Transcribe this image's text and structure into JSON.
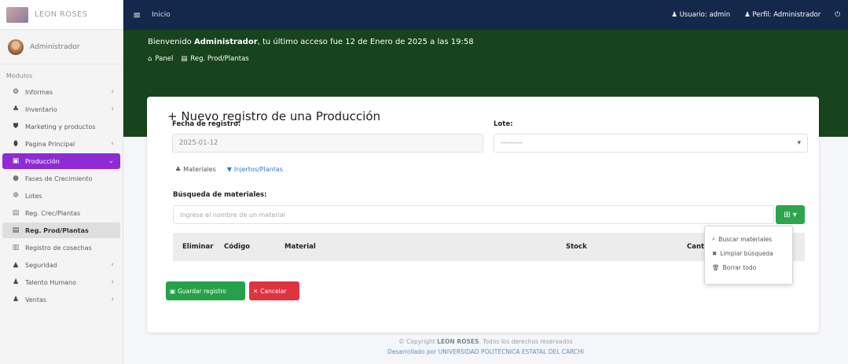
{
  "brand": {
    "name": "LEON ROSES"
  },
  "user": {
    "name": "Administrador"
  },
  "sidebar": {
    "section_label": "Modulos",
    "items": [
      {
        "icon": "⚙",
        "label": "Informes",
        "chevron": "‹"
      },
      {
        "icon": "♣",
        "label": "Inventario",
        "chevron": "‹"
      },
      {
        "icon": "⛊",
        "label": "Marketing y productos",
        "chevron": ""
      },
      {
        "icon": "⬮",
        "label": "Pagina Principal",
        "chevron": "‹"
      },
      {
        "icon": "▣",
        "label": "Producción",
        "chevron": "⌄"
      },
      {
        "icon": "●",
        "label": "Fases de Crecimiento",
        "chevron": ""
      },
      {
        "icon": "❁",
        "label": "Lotes",
        "chevron": ""
      },
      {
        "icon": "▤",
        "label": "Reg. Crec/Plantas",
        "chevron": ""
      },
      {
        "icon": "▤",
        "label": "Reg. Prod/Plantas",
        "chevron": ""
      },
      {
        "icon": "▥",
        "label": "Registro de cosechas",
        "chevron": ""
      },
      {
        "icon": "▲",
        "label": "Seguridad",
        "chevron": "‹"
      },
      {
        "icon": "♟",
        "label": "Talento Humano",
        "chevron": "‹"
      },
      {
        "icon": "♟",
        "label": "Ventas",
        "chevron": "‹"
      }
    ]
  },
  "topbar": {
    "menu_icon": "≡",
    "home_label": "Inicio",
    "user_link": "Usuario: admin",
    "profile_link": "Perfil: Administrador",
    "power_icon": "⏻"
  },
  "header": {
    "welcome_prefix": "Bienvenido ",
    "welcome_user": "Administrador",
    "welcome_suffix": ", tu último acceso fue 12 de Enero de 2025 a las 19:58",
    "breadcrumb_home": "Panel",
    "breadcrumb_current": "Reg. Prod/Plantas"
  },
  "form": {
    "title": "+ Nuevo registro de una Producción",
    "date_label": "Fecha de registro:",
    "date_value": "2025-01-12",
    "lot_label": "Lote:",
    "lot_value": "---------",
    "tab_materials": "Materiales",
    "tab_plants": "Injertos/Plantas",
    "search_label": "Búsqueda de materiales:",
    "search_placeholder": "Ingrese el nombre de un material",
    "search_button_icon": "⊞ ▾",
    "table_columns": [
      "Eliminar",
      "Código",
      "Material",
      "Stock",
      "Cant"
    ],
    "save_button": "Guardar registro",
    "cancel_button": "Cancelar"
  },
  "dropdown": {
    "items": [
      {
        "icon": "⌕",
        "label": "Buscar materiales"
      },
      {
        "icon": "✖",
        "label": "Limpiar búsqueda"
      },
      {
        "icon": "🗑",
        "label": "Borrar todo"
      }
    ]
  },
  "footer": {
    "line1_prefix": "© Copyright ",
    "line1_brand": "LEON ROSES",
    "line1_suffix": ". Todos los derechos reservados",
    "line2": "Desarrollado por UNIVERSIDAD POLITECNICA ESTATAL DEL CARCHI"
  },
  "colors": {
    "topbar": "#14284b",
    "header_band": "#17431d",
    "active_nav": "#8e2bd4",
    "save": "#26a14a",
    "cancel": "#e0323f"
  }
}
